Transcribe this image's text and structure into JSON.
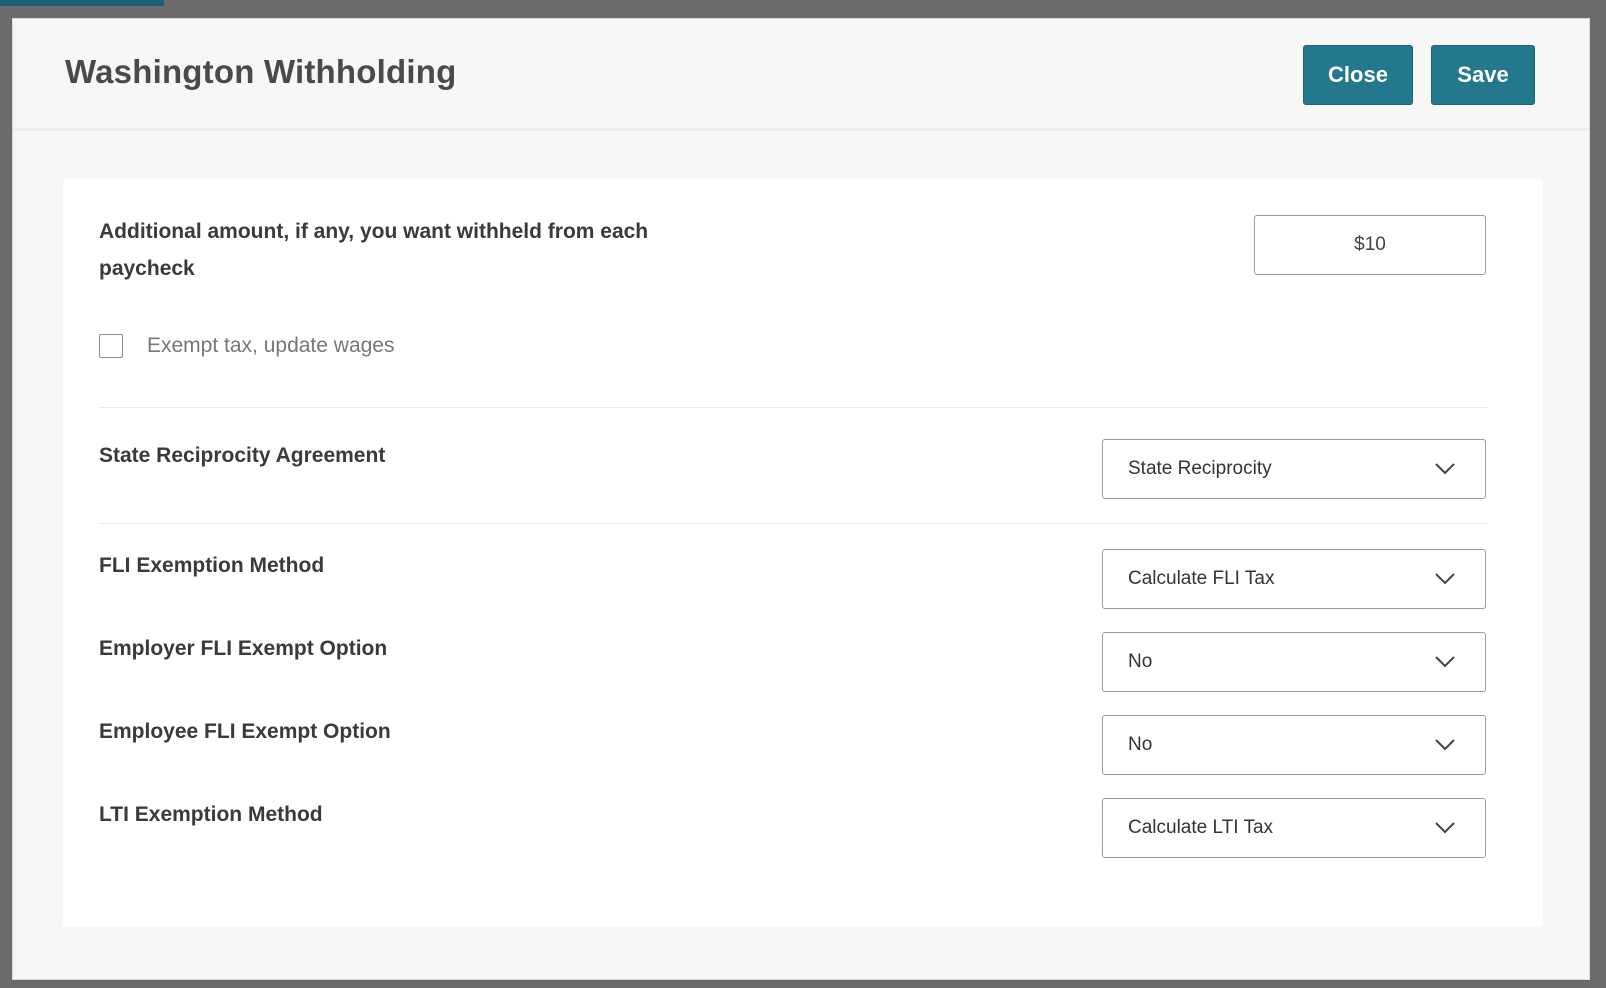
{
  "modal": {
    "title": "Washington Withholding",
    "close_label": "Close",
    "save_label": "Save"
  },
  "form": {
    "additional_amount": {
      "label": "Additional amount, if any, you want withheld from each paycheck",
      "value": "$10"
    },
    "exempt_checkbox": {
      "label": "Exempt tax, update wages",
      "checked": false
    },
    "fields": [
      {
        "label": "State Reciprocity Agreement",
        "value": "State Reciprocity"
      },
      {
        "label": "FLI Exemption Method",
        "value": "Calculate FLI Tax"
      },
      {
        "label": "Employer FLI Exempt Option",
        "value": "No"
      },
      {
        "label": "Employee FLI Exempt Option",
        "value": "No"
      },
      {
        "label": "LTI Exemption Method",
        "value": "Calculate LTI Tax"
      }
    ]
  },
  "icons": {
    "dropdown": "chevron-down-icon"
  },
  "colors": {
    "primary_button": "#24788d",
    "title_text": "#4a4a4a"
  }
}
